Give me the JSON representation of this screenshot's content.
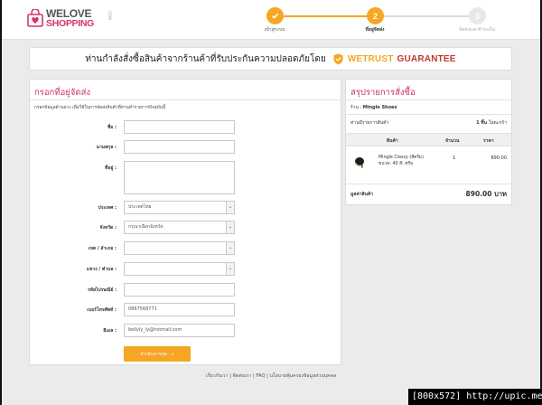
{
  "brand": {
    "line1": "WELOVE",
    "line2": "SHOPPING",
    "suffix": ".COM",
    "color": "#d6336c"
  },
  "steps": [
    {
      "num": "1",
      "label": "เข้าสู่ระบบ",
      "state": "done"
    },
    {
      "num": "2",
      "label": "ที่อยู่จัดส่ง",
      "state": "current"
    },
    {
      "num": "3",
      "label": "จัดส่งและชำระเงิน",
      "state": "todo"
    }
  ],
  "banner": {
    "text": "ท่านกำลังสั่งซื้อสินค้าจากร้านค้าที่รับประกันความปลอดภัยโดย",
    "brand1": "WETRUST",
    "brand2": "GUARANTEE",
    "colors": {
      "brand1": "#f5a623",
      "brand2": "#c0392b"
    }
  },
  "address": {
    "title": "กรอกที่อยู่จัดส่ง",
    "note": "กรอกข้อมูลด้านล่าง เพื่อใช้ในการจัดส่งสินค้าที่ท่านทำรายการปัจจุบันนี้",
    "fields": {
      "name": {
        "label": "ชื่อ :",
        "value": ""
      },
      "surname": {
        "label": "นามสกุล :",
        "value": ""
      },
      "address": {
        "label": "ที่อยู่ :",
        "value": ""
      },
      "country": {
        "label": "ประเทศ :",
        "value": "ประเทศไทย"
      },
      "province": {
        "label": "จังหวัด :",
        "value": "กรุณาเลือกจังหวัด"
      },
      "district": {
        "label": "เขต / อำเภอ :",
        "value": ""
      },
      "subdistrict": {
        "label": "แขวง / ตำบล :",
        "value": ""
      },
      "postcode": {
        "label": "รหัสไปรษณีย์ :",
        "value": ""
      },
      "phone": {
        "label": "เบอร์โทรศัพท์ :",
        "value": "0867568771"
      },
      "email": {
        "label": "อีเมล :",
        "value": "bellyly_ly@hotmail.com"
      }
    },
    "continue_label": "ดำเนินการต่อ"
  },
  "summary": {
    "title": "สรุปรายการสั่งซื้อ",
    "shop_label": "ร้าน :",
    "shop_name": "Mingle Shoes",
    "count_label": "ท่านมีรายการสินค้า",
    "count_value": "1 ชิ้น",
    "count_suffix": "ในตะกร้า",
    "columns": {
      "product": "สินค้า",
      "qty": "จำนวน",
      "price": "ราคา"
    },
    "items": [
      {
        "name": "Mingle Classy (สีครีม)",
        "size": "ขนาด: 40 สี: ครีม",
        "qty": "1",
        "price": "890.00"
      }
    ],
    "total_label": "มูลค่าสินค้า",
    "total_value": "890.00 บาท"
  },
  "footer": {
    "links": "เกี่ยวกับเรา | ติดต่อเรา | FAQ | นโยบายคุ้มครองข้อมูลส่วนบุคคล"
  },
  "watermark": {
    "size_text": "[800x572]",
    "url": "http://upic.me/"
  }
}
